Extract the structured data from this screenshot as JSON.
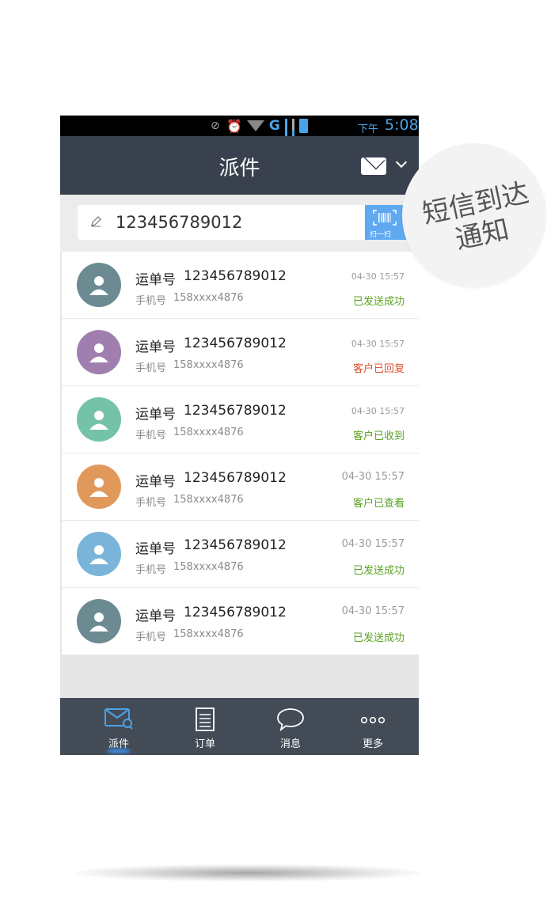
{
  "status_bar": {
    "ampm": "下午",
    "time": "5:08"
  },
  "header": {
    "title": "派件",
    "mail_icon": "mail-icon",
    "dropdown_icon": "chevron-down-icon"
  },
  "search": {
    "value": "123456789012",
    "scan_label": "扫一扫"
  },
  "callout": {
    "line1": "短信到达",
    "line2": "通知"
  },
  "list": {
    "items": [
      {
        "waybill_label": "运单号",
        "waybill_no": "123456789012",
        "phone_label": "手机号",
        "phone_no": "158xxxx4876",
        "time": "04-30 15:57",
        "status": "已发送成功",
        "status_color": "#5aa320",
        "avatar_color": "#6b8a91"
      },
      {
        "waybill_label": "运单号",
        "waybill_no": "123456789012",
        "phone_label": "手机号",
        "phone_no": "158xxxx4876",
        "time": "04-30 15:57",
        "status": "客户已回复",
        "status_color": "#e0502f",
        "avatar_color": "#a07fb0"
      },
      {
        "waybill_label": "运单号",
        "waybill_no": "123456789012",
        "phone_label": "手机号",
        "phone_no": "158xxxx4876",
        "time": "04-30 15:57",
        "status": "客户已收到",
        "status_color": "#5aa320",
        "avatar_color": "#74c3a9"
      },
      {
        "waybill_label": "运单号",
        "waybill_no": "123456789012",
        "phone_label": "手机号",
        "phone_no": "158xxxx4876",
        "time": "04-30 15:57",
        "status": "客户已查看",
        "status_color": "#5aa320",
        "avatar_color": "#e0995a"
      },
      {
        "waybill_label": "运单号",
        "waybill_no": "123456789012",
        "phone_label": "手机号",
        "phone_no": "158xxxx4876",
        "time": "04-30 15:57",
        "status": "已发送成功",
        "status_color": "#5aa320",
        "avatar_color": "#7ab5d9"
      },
      {
        "waybill_label": "运单号",
        "waybill_no": "123456789012",
        "phone_label": "手机号",
        "phone_no": "158xxxx4876",
        "time": "04-30 15:57",
        "status": "已发送成功",
        "status_color": "#5aa320",
        "avatar_color": "#6b8a91"
      }
    ]
  },
  "tabs": [
    {
      "label": "派件",
      "icon": "mail-search-icon"
    },
    {
      "label": "订单",
      "icon": "document-icon"
    },
    {
      "label": "消息",
      "icon": "chat-bubble-icon"
    },
    {
      "label": "更多",
      "icon": "more-dots-icon"
    }
  ]
}
